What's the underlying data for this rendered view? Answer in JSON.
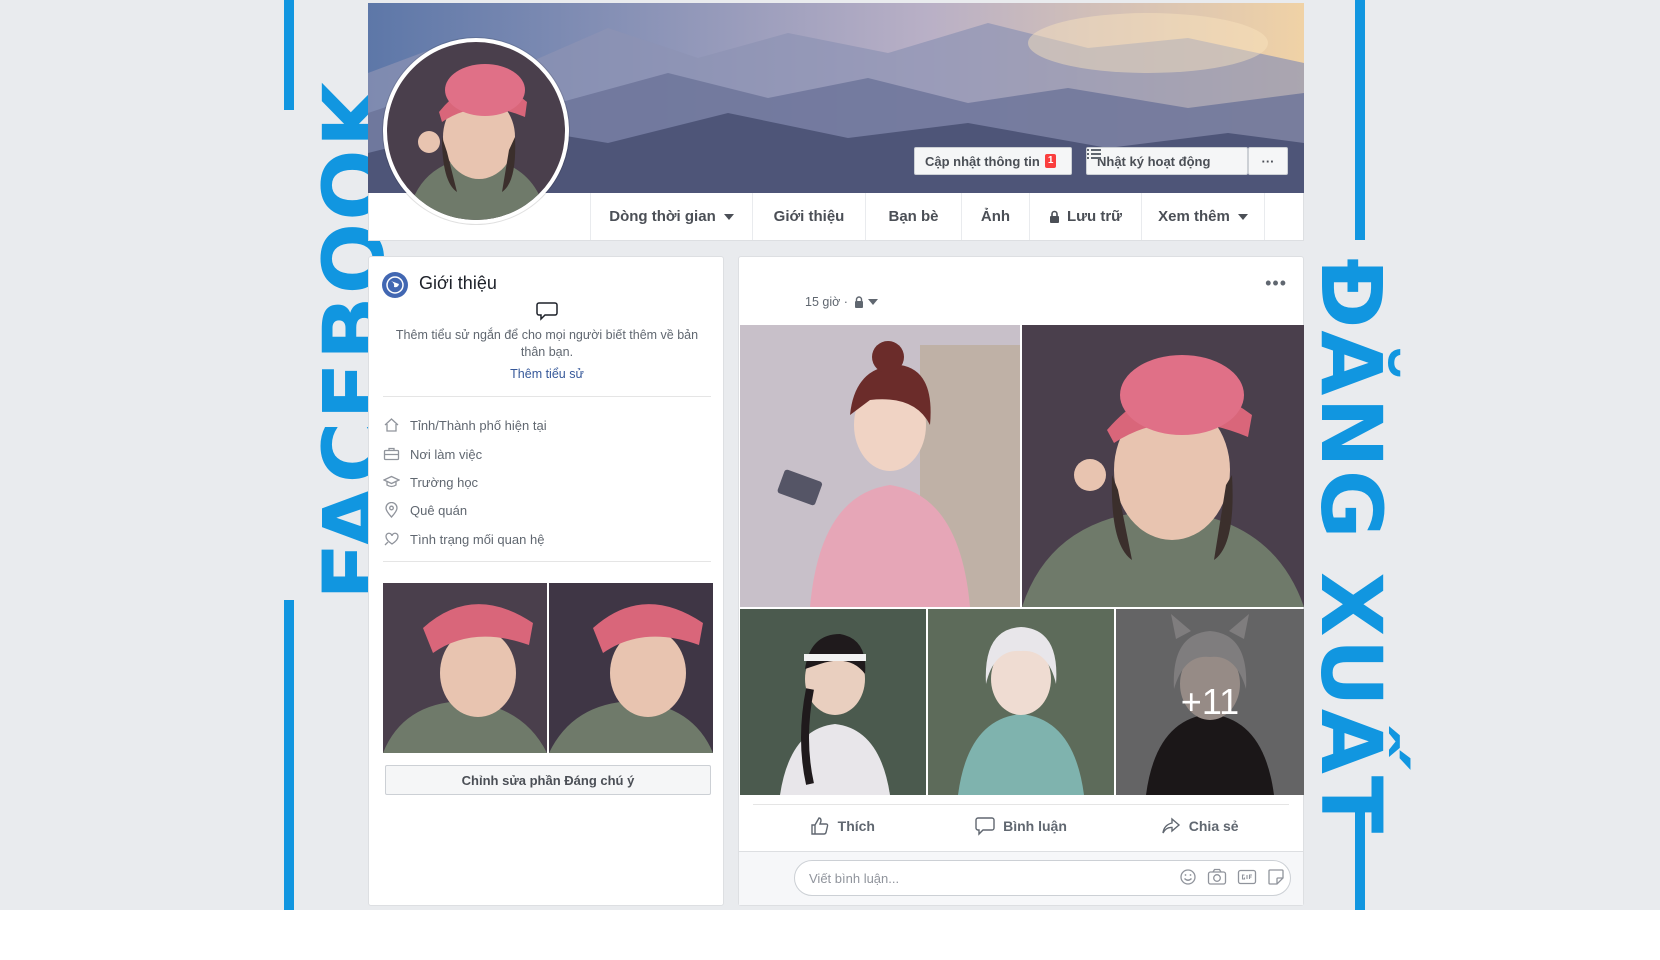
{
  "side_labels": {
    "left": "FACEBOOK",
    "right": "ĐĂNG XUẤT"
  },
  "cover": {
    "update_info_label": "Cập nhật thông tin",
    "update_info_badge": "1",
    "activity_log_label": "Nhật ký hoạt động",
    "more_label": "···"
  },
  "nav": {
    "timeline": "Dòng thời gian",
    "about": "Giới thiệu",
    "friends": "Bạn bè",
    "photos": "Ảnh",
    "archive": "Lưu trữ",
    "more": "Xem thêm"
  },
  "intro": {
    "title": "Giới thiệu",
    "description": "Thêm tiểu sử ngắn để cho mọi người biết thêm về bản thân bạn.",
    "add_bio_link": "Thêm tiểu sử",
    "items": [
      {
        "icon": "home-icon",
        "label": "Tỉnh/Thành phố hiện tại"
      },
      {
        "icon": "briefcase-icon",
        "label": "Nơi làm việc"
      },
      {
        "icon": "graduation-cap-icon",
        "label": "Trường học"
      },
      {
        "icon": "location-pin-icon",
        "label": "Quê quán"
      },
      {
        "icon": "heart-icon",
        "label": "Tình trạng mối quan hệ"
      }
    ],
    "edit_featured_label": "Chỉnh sửa phần Đáng chú ý"
  },
  "post": {
    "time": "15 giờ ·",
    "more": "•••",
    "extra_photos": "+11",
    "like_label": "Thích",
    "comment_label": "Bình luận",
    "share_label": "Chia sẻ",
    "comment_placeholder": "Viết bình luận..."
  },
  "colors": {
    "accent_blue": "#1196e0",
    "facebook_blue": "#4267b2",
    "link_blue": "#365899",
    "badge_red": "#fa3e3e"
  }
}
